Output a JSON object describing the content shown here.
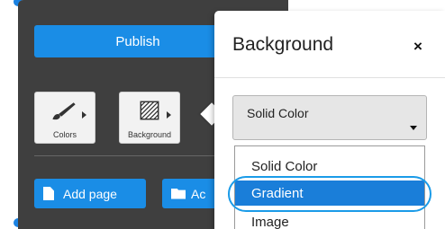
{
  "editor": {
    "publish_label": "Publish",
    "tools": [
      {
        "label": "Colors",
        "icon": "brush-icon"
      },
      {
        "label": "Background",
        "icon": "hatch-pattern-icon"
      }
    ],
    "add_page_label": "Add page",
    "add_folder_label": "Ac"
  },
  "popover": {
    "title": "Background",
    "close_glyph": "×",
    "select_value": "Solid Color",
    "options": [
      "Solid Color",
      "Gradient",
      "Image"
    ],
    "selected_index": 1
  },
  "colors": {
    "accent": "#1a8de6",
    "panel": "#3f3f3f",
    "highlight": "#1a7ed9"
  }
}
